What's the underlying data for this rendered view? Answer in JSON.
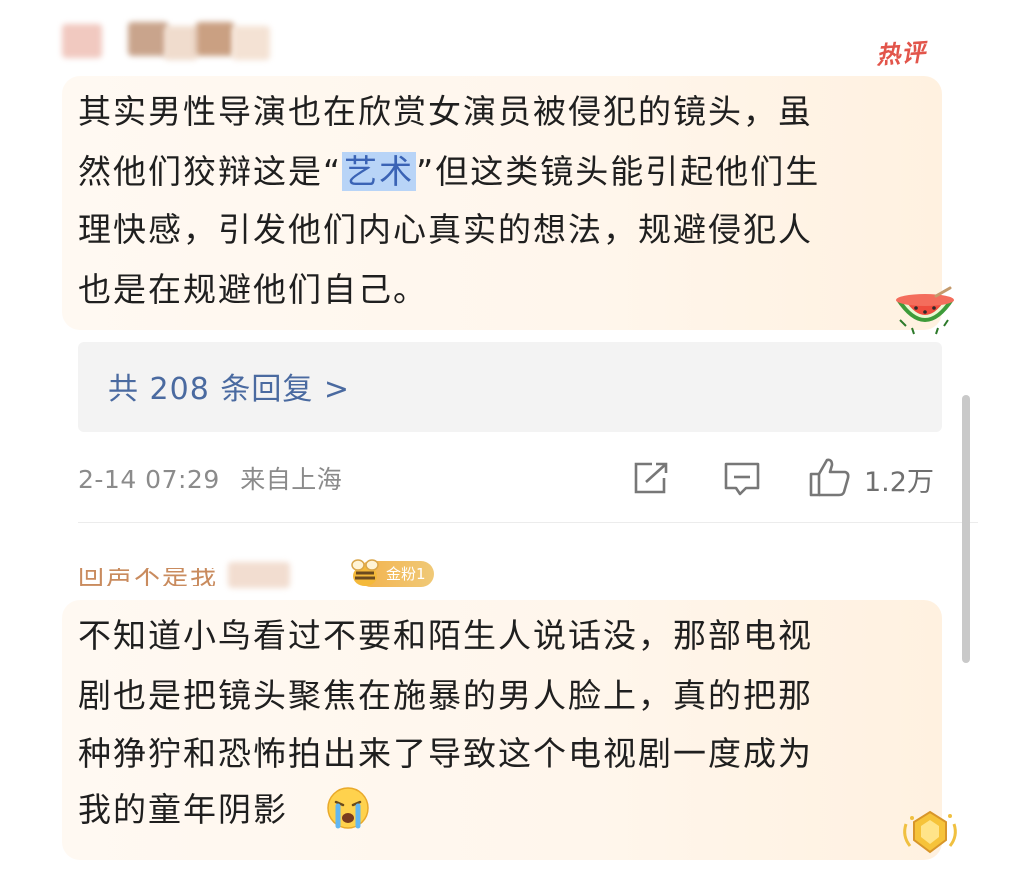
{
  "comment1": {
    "hot_tag": "热评",
    "lines": [
      "其实男性导演也在欣赏女演员被侵犯的镜头，虽",
      "然他们狡辩这是“",
      "理快感，引发他们内心真实的想法，规避侵犯人",
      "也是在规避他们自己。"
    ],
    "highlight": "艺术",
    "line2_rest": "”但这类镜头能引起他们生",
    "replies_label": "共 208 条回复 >",
    "timestamp": "2-14 07:29",
    "location": "来自上海",
    "like_count": "1.2万"
  },
  "comment2": {
    "username_cut": "回声不是我",
    "fan_badge": "金粉1",
    "lines": [
      "不知道小鸟看过不要和陌生人说话没，那部电视",
      "剧也是把镜头聚焦在施暴的男人脸上，真的把那",
      "种狰狞和恐怖拍出来了导致这个电视剧一度成为",
      "我的童年阴影"
    ]
  },
  "icons": {
    "share": "share-icon",
    "comment": "comment-icon",
    "like": "thumbs-up-icon",
    "melon": "watermelon-emoji",
    "cry": "crying-emoji",
    "medal": "medal-badge-icon"
  },
  "colors": {
    "accent_link": "#4a6aa0",
    "hot_red": "#e2554b",
    "highlight_bg": "#b8d4f7",
    "badge_gold": "#f3b24c"
  }
}
